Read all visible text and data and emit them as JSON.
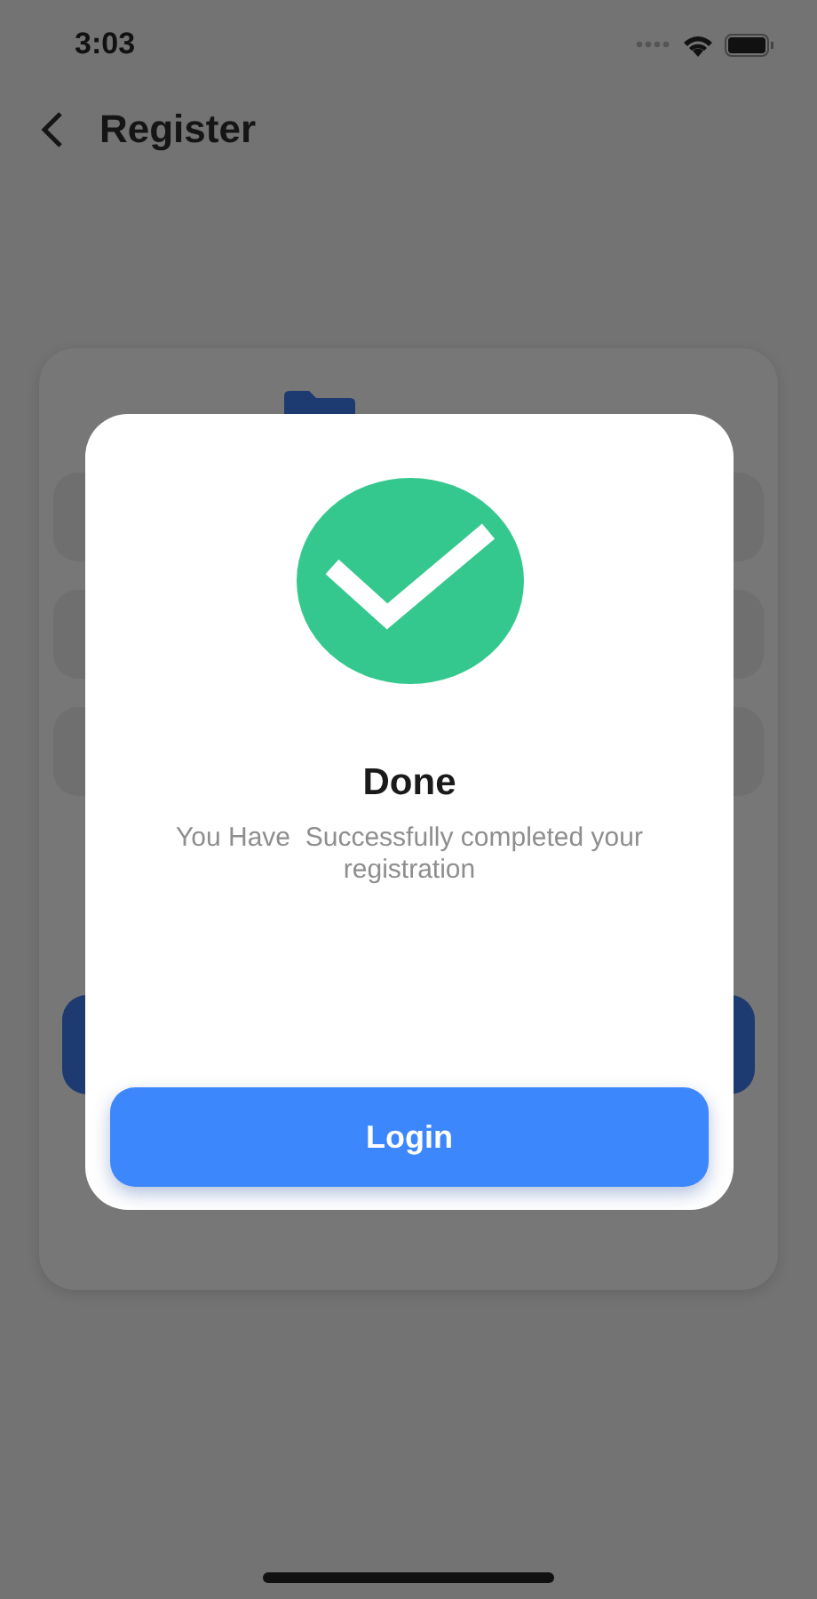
{
  "status_bar": {
    "time": "3:03"
  },
  "header": {
    "title": "Register"
  },
  "dialog": {
    "title": "Done",
    "message": "You Have  Successfully completed your registration",
    "button": "Login"
  }
}
